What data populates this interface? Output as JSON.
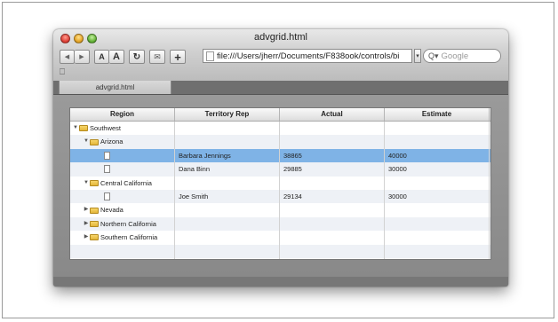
{
  "window": {
    "title": "advgrid.html"
  },
  "toolbar": {
    "back_icon": "back-arrow-icon",
    "forward_icon": "forward-arrow-icon",
    "text_smaller_label": "A",
    "text_larger_label": "A",
    "reload_icon": "reload-icon",
    "snippet_icon": "snippet-icon",
    "add_label": "+",
    "url": "file:///Users/jherr/Documents/F838ook/controls/bi",
    "search_placeholder": "Google"
  },
  "bookmarks": {
    "icon": "book-icon",
    "label": "⎕"
  },
  "tabs": [
    {
      "label": "advgrid.html"
    }
  ],
  "grid": {
    "columns": [
      "Region",
      "Territory Rep",
      "Actual",
      "Estimate"
    ],
    "rows": [
      {
        "level": 0,
        "type": "folder",
        "expanded": true,
        "region": "Southwest",
        "rep": "",
        "actual": "",
        "estimate": "",
        "selected": false
      },
      {
        "level": 1,
        "type": "folder",
        "expanded": true,
        "region": "Arizona",
        "rep": "",
        "actual": "",
        "estimate": "",
        "selected": false
      },
      {
        "level": 2,
        "type": "leaf",
        "expanded": false,
        "region": "",
        "rep": "Barbara Jennings",
        "actual": "38865",
        "estimate": "40000",
        "selected": true
      },
      {
        "level": 2,
        "type": "leaf",
        "expanded": false,
        "region": "",
        "rep": "Dana Binn",
        "actual": "29885",
        "estimate": "30000",
        "selected": false
      },
      {
        "level": 1,
        "type": "folder",
        "expanded": true,
        "region": "Central California",
        "rep": "",
        "actual": "",
        "estimate": "",
        "selected": false
      },
      {
        "level": 2,
        "type": "leaf",
        "expanded": false,
        "region": "",
        "rep": "Joe Smith",
        "actual": "29134",
        "estimate": "30000",
        "selected": false
      },
      {
        "level": 1,
        "type": "folder",
        "expanded": false,
        "region": "Nevada",
        "rep": "",
        "actual": "",
        "estimate": "",
        "selected": false
      },
      {
        "level": 1,
        "type": "folder",
        "expanded": false,
        "region": "Northern California",
        "rep": "",
        "actual": "",
        "estimate": "",
        "selected": false
      },
      {
        "level": 1,
        "type": "folder",
        "expanded": false,
        "region": "Southern California",
        "rep": "",
        "actual": "",
        "estimate": "",
        "selected": false
      },
      {
        "level": -1,
        "type": "empty",
        "expanded": false,
        "region": "",
        "rep": "",
        "actual": "",
        "estimate": "",
        "selected": false
      },
      {
        "level": -1,
        "type": "empty",
        "expanded": false,
        "region": "",
        "rep": "",
        "actual": "",
        "estimate": "",
        "selected": false
      }
    ]
  },
  "colors": {
    "selection": "#7fb3e6",
    "alt_row": "#eef1f6",
    "folder": "#e3b63a"
  }
}
